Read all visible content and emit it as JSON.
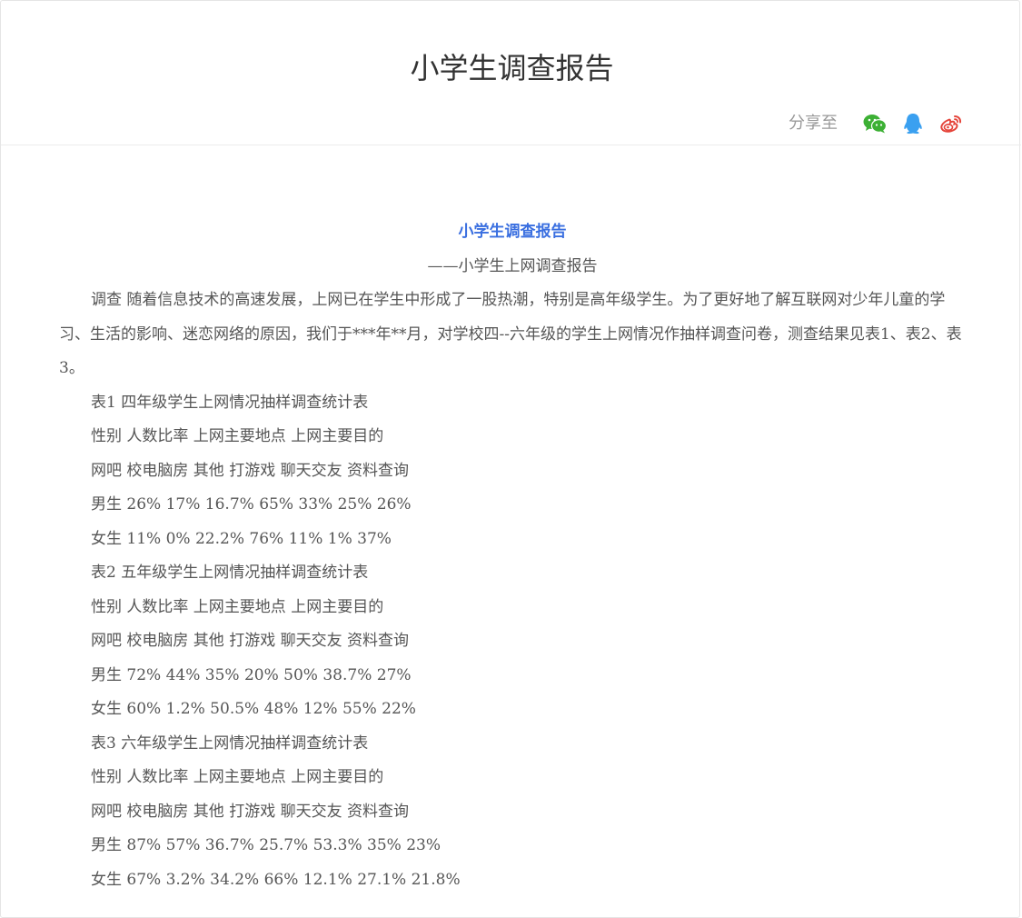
{
  "header": {
    "title": "小学生调查报告",
    "share_label": "分享至",
    "share_icons": [
      "wechat-icon",
      "qq-icon",
      "weibo-icon"
    ]
  },
  "colors": {
    "title_text": "#333333",
    "article_title": "#3a6fe0",
    "body_text": "#555555",
    "wechat": "#3cb034",
    "qq": "#3aa0f0",
    "weibo": "#e5443a"
  },
  "article": {
    "title": "小学生调查报告",
    "subtitle": "——小学生上网调查报告",
    "paragraphs": [
      "调查 随着信息技术的高速发展，上网已在学生中形成了一股热潮，特别是高年级学生。为了更好地了解互联网对少年儿童的学习、生活的影响、迷恋网络的原因，我们于***年**月，对学校四--六年级的学生上网情况作抽样调查问卷，测查结果见表1、表2、表3。",
      "表1 四年级学生上网情况抽样调查统计表",
      "性别 人数比率 上网主要地点 上网主要目的",
      "网吧 校电脑房 其他 打游戏 聊天交友 资料查询",
      "男生 26% 17% 16.7% 65% 33% 25% 26%",
      "女生 11% 0% 22.2% 76% 11% 1% 37%",
      "表2 五年级学生上网情况抽样调查统计表",
      "性别 人数比率 上网主要地点 上网主要目的",
      "网吧 校电脑房 其他 打游戏 聊天交友 资料查询",
      "男生 72% 44% 35% 20% 50% 38.7% 27%",
      "女生 60% 1.2% 50.5% 48% 12% 55% 22%",
      "表3 六年级学生上网情况抽样调查统计表",
      "性别 人数比率 上网主要地点 上网主要目的",
      "网吧 校电脑房 其他 打游戏 聊天交友 资料查询",
      "男生 87% 57% 36.7% 25.7% 53.3% 35% 23%",
      "女生 67% 3.2% 34.2% 66% 12.1% 27.1% 21.8%"
    ]
  }
}
